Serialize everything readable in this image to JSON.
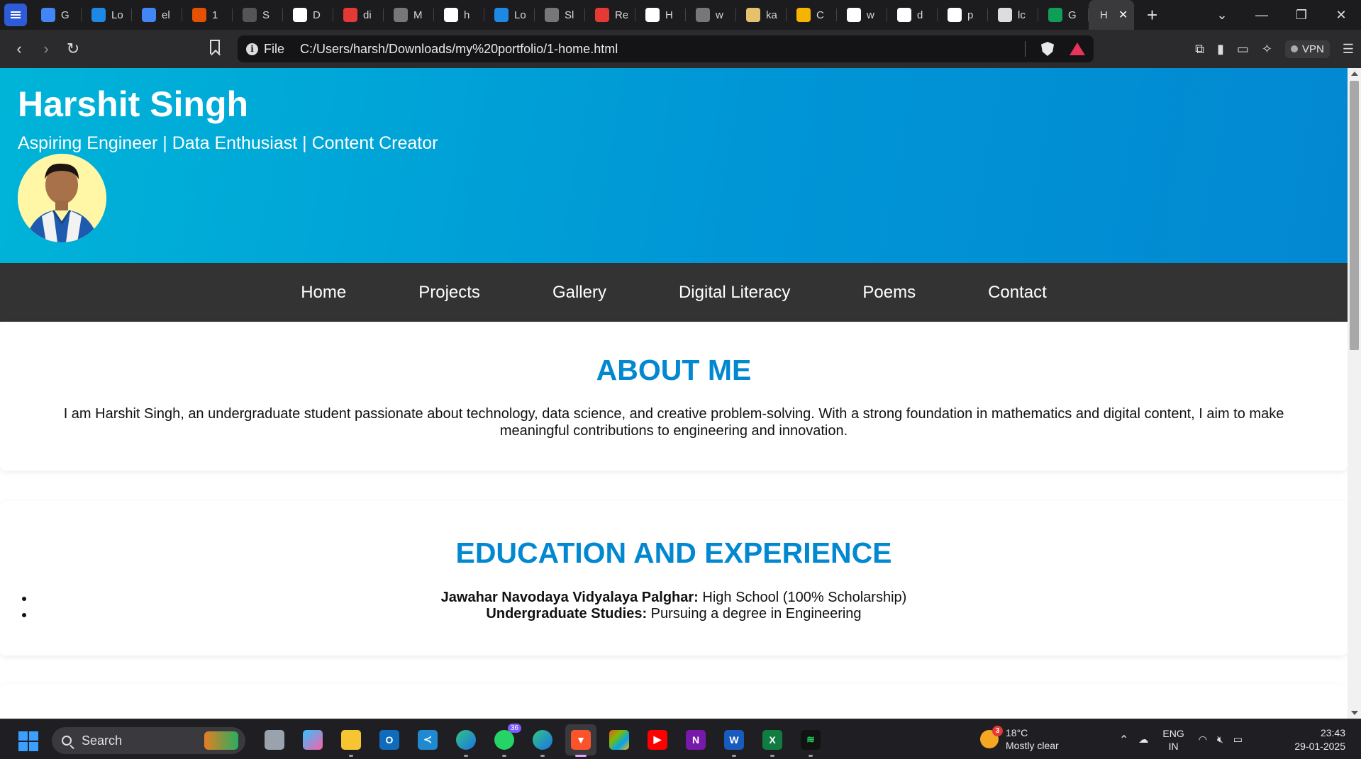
{
  "browser": {
    "tabs": [
      {
        "title": "G",
        "icon": "docs-icon",
        "color": "#4285f4"
      },
      {
        "title": "Lo",
        "icon": "cloud-icon",
        "color": "#1e88e5"
      },
      {
        "title": "el",
        "icon": "docs-icon",
        "color": "#4285f4"
      },
      {
        "title": "1",
        "icon": "fire-icon",
        "color": "#e65100"
      },
      {
        "title": "S",
        "icon": "openai-icon",
        "color": "#555555"
      },
      {
        "title": "D",
        "icon": "wix-icon",
        "color": "#ffffff"
      },
      {
        "title": "di",
        "icon": "youtube-icon",
        "color": "#e53935"
      },
      {
        "title": "M",
        "icon": "globe-icon",
        "color": "#777777"
      },
      {
        "title": "h",
        "icon": "google-icon",
        "color": "#ffffff"
      },
      {
        "title": "Lo",
        "icon": "cloud-icon",
        "color": "#1e88e5"
      },
      {
        "title": "Sl",
        "icon": "globe-icon",
        "color": "#777777"
      },
      {
        "title": "Re",
        "icon": "gmail-icon",
        "color": "#e53935"
      },
      {
        "title": "H",
        "icon": "wix-icon",
        "color": "#ffffff"
      },
      {
        "title": "w",
        "icon": "globe-icon",
        "color": "#777777"
      },
      {
        "title": "ka",
        "icon": "g-icon",
        "color": "#e5c16b"
      },
      {
        "title": "C",
        "icon": "slides-icon",
        "color": "#f4b400"
      },
      {
        "title": "w",
        "icon": "google-icon",
        "color": "#ffffff"
      },
      {
        "title": "d",
        "icon": "google-icon",
        "color": "#ffffff"
      },
      {
        "title": "p",
        "icon": "google-icon",
        "color": "#ffffff"
      },
      {
        "title": "lc",
        "icon": "openai-icon",
        "color": "#dddddd"
      },
      {
        "title": "G",
        "icon": "sheets-icon",
        "color": "#0f9d58"
      }
    ],
    "active_tab": {
      "title": "H"
    },
    "file_label": "File",
    "url": "C:/Users/harsh/Downloads/my%20portfolio/1-home.html",
    "vpn_label": "VPN"
  },
  "site": {
    "name": "Harshit Singh",
    "tagline": "Aspiring Engineer | Data Enthusiast | Content Creator",
    "nav": [
      "Home",
      "Projects",
      "Gallery",
      "Digital Literacy",
      "Poems",
      "Contact"
    ],
    "about": {
      "heading": "ABOUT ME",
      "text": "I am Harshit Singh, an undergraduate student passionate about technology, data science, and creative problem-solving. With a strong foundation in mathematics and digital content, I aim to make meaningful contributions to engineering and innovation."
    },
    "education": {
      "heading": "EDUCATION AND EXPERIENCE",
      "items": [
        {
          "label": "Jawahar Navodaya Vidyalaya Palghar:",
          "detail": " High School (100% Scholarship)"
        },
        {
          "label": "Undergraduate Studies:",
          "detail": " Pursuing a degree in Engineering"
        }
      ]
    }
  },
  "taskbar": {
    "search_placeholder": "Search",
    "whatsapp_badge": "36",
    "weather_badge": "3",
    "temperature": "18°C",
    "condition": "Mostly clear",
    "lang_primary": "ENG",
    "lang_secondary": "IN",
    "time": "23:43",
    "date": "29-01-2025"
  }
}
